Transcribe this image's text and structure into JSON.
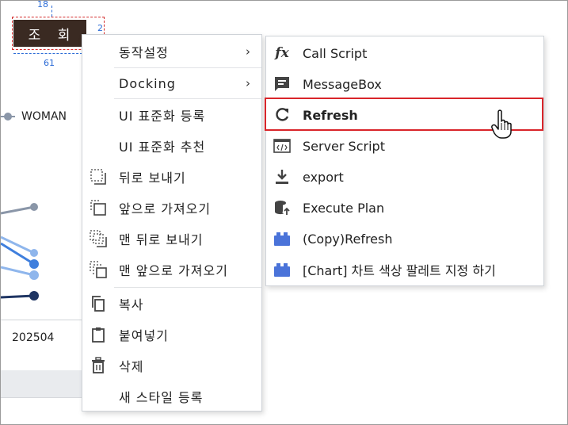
{
  "canvas": {
    "query_button_label": "조 회",
    "dim_top": "18",
    "dim_right": "2",
    "dim_bottom": "61",
    "legend_label": "WOMAN",
    "axis_tick": "202504"
  },
  "context_menu": {
    "items": [
      {
        "label": "동작설정",
        "has_submenu": true,
        "icon": ""
      },
      {
        "label": "Docking",
        "has_submenu": true,
        "icon": ""
      },
      {
        "label": "UI 표준화 등록",
        "has_submenu": false,
        "icon": ""
      },
      {
        "label": "UI 표준화 추천",
        "has_submenu": false,
        "icon": ""
      },
      {
        "label": "뒤로 보내기",
        "has_submenu": false,
        "icon": "send-backward-icon"
      },
      {
        "label": "앞으로 가져오기",
        "has_submenu": false,
        "icon": "bring-forward-icon"
      },
      {
        "label": "맨 뒤로 보내기",
        "has_submenu": false,
        "icon": "send-to-back-icon"
      },
      {
        "label": "맨 앞으로 가져오기",
        "has_submenu": false,
        "icon": "bring-to-front-icon"
      },
      {
        "label": "복사",
        "has_submenu": false,
        "icon": "copy-icon"
      },
      {
        "label": "붙여넣기",
        "has_submenu": false,
        "icon": "paste-icon"
      },
      {
        "label": "삭제",
        "has_submenu": false,
        "icon": "trash-icon"
      },
      {
        "label": "새 스타일 등록",
        "has_submenu": false,
        "icon": ""
      }
    ]
  },
  "submenu": {
    "items": [
      {
        "label": "Call Script",
        "icon": "function-icon"
      },
      {
        "label": "MessageBox",
        "icon": "message-icon"
      },
      {
        "label": "Refresh",
        "icon": "refresh-icon",
        "highlighted": true
      },
      {
        "label": "Server Script",
        "icon": "code-icon"
      },
      {
        "label": "export",
        "icon": "download-icon"
      },
      {
        "label": "Execute Plan",
        "icon": "database-icon"
      },
      {
        "label": "(Copy)Refresh",
        "icon": "block-icon"
      },
      {
        "label": "[Chart] 차트 색상 팔레트 지정 하기",
        "icon": "block-icon"
      }
    ]
  },
  "colors": {
    "query_button_bg": "#3a2a22",
    "highlight_border": "#d9252a",
    "block_icon": "#4a73d9",
    "series_dark": "#1f3563",
    "series_mid": "#3f7fdd",
    "series_light": "#8fb6ec",
    "series_grey": "#8a96a8"
  }
}
